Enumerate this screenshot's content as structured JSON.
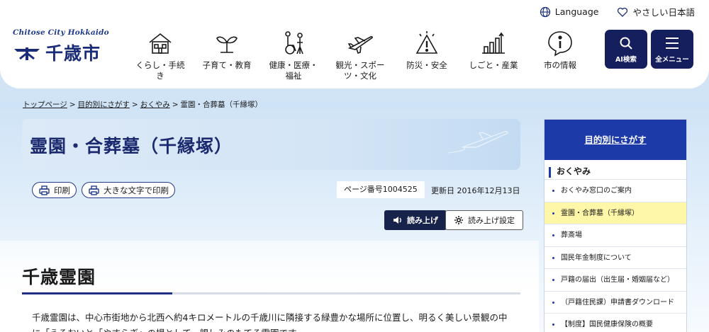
{
  "header": {
    "utility": {
      "language": "Language",
      "easy_japanese": "やさしい日本語"
    },
    "logo": {
      "tagline": "Chitose City Hokkaido",
      "name": "千歳市"
    },
    "nav": [
      {
        "label": "くらし・手続き",
        "icon": "house-icon"
      },
      {
        "label": "子育て・教育",
        "icon": "sprout-icon"
      },
      {
        "label": "健康・医療・福祉",
        "icon": "wheelchair-icon"
      },
      {
        "label": "観光・スポーツ・文化",
        "icon": "airplane-icon"
      },
      {
        "label": "防災・安全",
        "icon": "warning-icon"
      },
      {
        "label": "しごと・産業",
        "icon": "bar-chart-icon"
      },
      {
        "label": "市の情報",
        "icon": "info-icon"
      }
    ],
    "ai_search": "AI検索",
    "all_menu": "全メニュー"
  },
  "breadcrumb": [
    {
      "label": "トップページ",
      "link": true
    },
    {
      "label": "目的別にさがす",
      "link": true
    },
    {
      "label": "おくやみ",
      "link": true
    },
    {
      "label": "霊園・合葬墓（千縁塚）",
      "link": false
    }
  ],
  "page": {
    "title": "霊園・合葬墓（千縁塚）",
    "print": "印刷",
    "big_print": "大きな文字で印刷",
    "page_number": "ページ番号1004525",
    "updated": "更新日 2016年12月13日",
    "read_aloud": "読み上げ",
    "read_settings": "読み上げ設定",
    "section_title": "千歳霊園",
    "body": "千歳霊園は、中心市街地から北西へ約4キロメートルの千歳川に隣接する緑豊かな場所に位置し、明るく美しい景観の中に「うるおいと「やすらぎ」の場として、親しみのもてる霊園です。"
  },
  "side": {
    "head": "目的別にさがす",
    "sub": "おくやみ",
    "items": [
      {
        "label": "おくやみ窓口のご案内",
        "active": false
      },
      {
        "label": "霊園・合葬墓（千縁塚）",
        "active": true
      },
      {
        "label": "葬斎場",
        "active": false
      },
      {
        "label": "国民年金制度について",
        "active": false
      },
      {
        "label": "戸籍の届出（出生届・婚姻届など）",
        "active": false
      },
      {
        "label": "（戸籍住民課）申請書ダウンロード",
        "active": false
      },
      {
        "label": "【制度】国民健康保険の概要",
        "active": false
      }
    ]
  },
  "colors": {
    "primary": "#1c3aa8",
    "navy": "#151f5e",
    "highlight": "#fff7a8"
  }
}
